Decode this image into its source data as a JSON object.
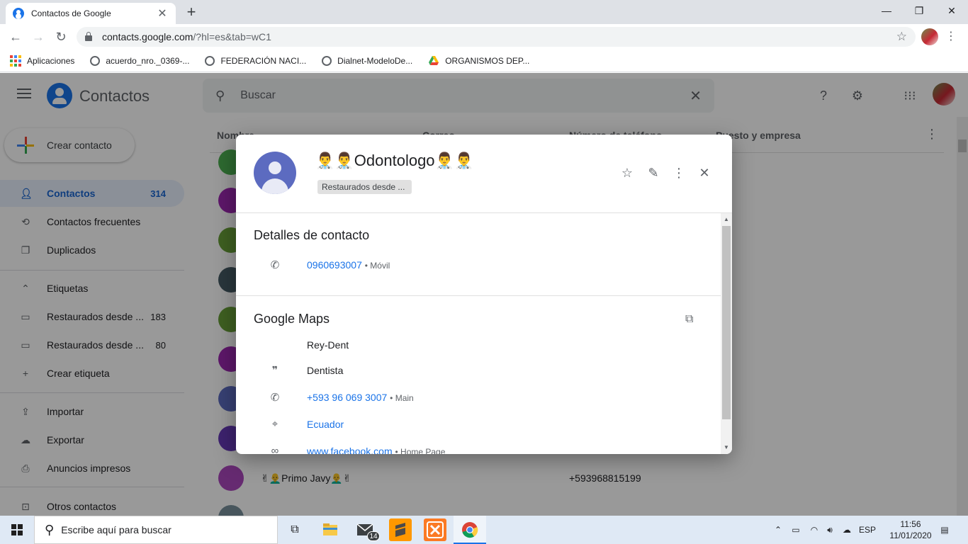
{
  "browser": {
    "tab_title": "Contactos de Google",
    "tab_close": "✕",
    "new_tab": "+",
    "url_host": "contacts.google.com",
    "url_path": "/?hl=es&tab=wC1",
    "window_controls": {
      "minimize": "—",
      "restore": "❐",
      "close": "✕"
    },
    "bookmarks": [
      {
        "label": "Aplicaciones",
        "icon": "apps-grid-icon"
      },
      {
        "label": "acuerdo_nro._0369-...",
        "icon": "globe-icon"
      },
      {
        "label": "FEDERACIÓN NACI...",
        "icon": "globe-icon"
      },
      {
        "label": "Dialnet-ModeloDe...",
        "icon": "globe-icon"
      },
      {
        "label": "ORGANISMOS DEP...",
        "icon": "drive-icon"
      }
    ]
  },
  "app": {
    "title": "Contactos",
    "search_placeholder": "Buscar",
    "create_contact": "Crear contacto",
    "sidebar": {
      "items": [
        {
          "label": "Contactos",
          "count": "314",
          "icon": "person-icon"
        },
        {
          "label": "Contactos frecuentes",
          "count": "",
          "icon": "history-icon"
        },
        {
          "label": "Duplicados",
          "count": "",
          "icon": "copy-icon"
        }
      ],
      "labels_header": "Etiquetas",
      "labels": [
        {
          "label": "Restaurados desde ...",
          "count": "183"
        },
        {
          "label": "Restaurados desde ...",
          "count": "80"
        }
      ],
      "create_label": "Crear etiqueta",
      "tools": [
        {
          "label": "Importar",
          "icon": "upload-icon"
        },
        {
          "label": "Exportar",
          "icon": "cloud-download-icon"
        },
        {
          "label": "Anuncios impresos",
          "icon": "print-icon"
        },
        {
          "label": "Otros contactos",
          "icon": "archive-icon"
        }
      ]
    },
    "columns": {
      "name": "Nombre",
      "email": "Correo",
      "phone": "Número de teléfono",
      "job": "Puesto y empresa"
    },
    "visible_rows": [
      {
        "name": "✌👨‍🦲Primo Javy👨‍🦲✌",
        "phone": "+593968815199"
      }
    ]
  },
  "dialog": {
    "name": "👨‍⚕️👨‍⚕️Odontologo👨‍⚕️👨‍⚕️",
    "label_chip": "Restaurados desde ...",
    "section_contact": "Detalles de contacto",
    "phone": "0960693007",
    "phone_type": "• Móvil",
    "section_maps": "Google Maps",
    "maps": {
      "business": "Rey-Dent",
      "category": "Dentista",
      "phone": "+593 96 069 3007",
      "phone_type": "• Main",
      "location": "Ecuador",
      "website": "www.facebook.com",
      "website_type": "• Home Page"
    }
  },
  "taskbar": {
    "search_placeholder": "Escribe aquí para buscar",
    "mail_badge": "14",
    "language": "ESP",
    "time": "11:56",
    "date": "11/01/2020"
  },
  "colors": {
    "accent": "#1a73e8",
    "link": "#1a73e8",
    "overlay": "rgba(0,0,0,0.4)"
  }
}
